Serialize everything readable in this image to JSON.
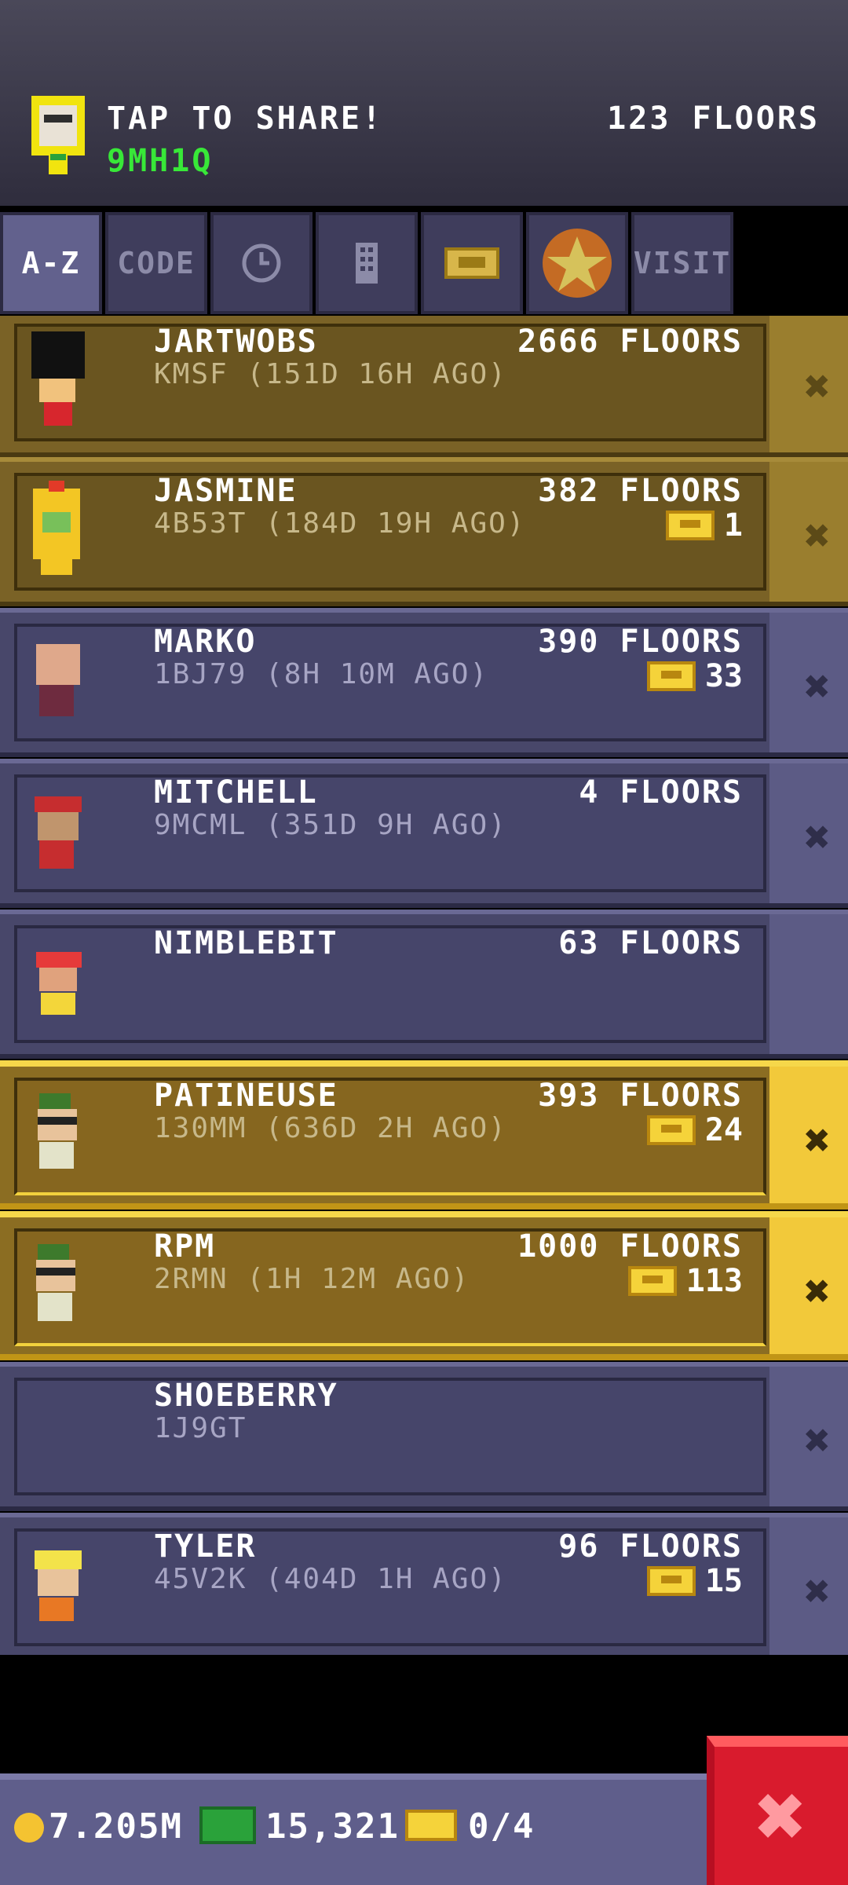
{
  "header": {
    "share_label": "TAP TO SHARE!",
    "share_code": "9MH1Q",
    "floors": "123 FLOORS"
  },
  "tabs": [
    {
      "label": "A-Z",
      "active": true
    },
    {
      "label": "CODE"
    },
    {
      "icon": "clock-icon"
    },
    {
      "icon": "building-icon"
    },
    {
      "icon": "bux-icon"
    },
    {
      "icon": "star-medal-icon"
    },
    {
      "label": "VISIT"
    }
  ],
  "rows": [
    {
      "name": "JARTWOBS",
      "floors": "2666 FLOORS",
      "sub": "KMSF (151D 16H AGO)",
      "bux": "",
      "style": "gold"
    },
    {
      "name": "JASMINE",
      "floors": "382 FLOORS",
      "sub": "4B53T (184D 19H AGO)",
      "bux": "1",
      "style": "gold"
    },
    {
      "name": "MARKO",
      "floors": "390 FLOORS",
      "sub": "1BJ79 (8H 10M AGO)",
      "bux": "33",
      "style": "purple"
    },
    {
      "name": "MITCHELL",
      "floors": "4 FLOORS",
      "sub": "9MCML (351D 9H AGO)",
      "bux": "",
      "style": "purple"
    },
    {
      "name": "NIMBLEBIT",
      "floors": "63 FLOORS",
      "sub": "",
      "bux": "",
      "style": "purple"
    },
    {
      "name": "PATINEUSE",
      "floors": "393 FLOORS",
      "sub": "130MM (636D 2H AGO)",
      "bux": "24",
      "style": "goldbright"
    },
    {
      "name": "RPM",
      "floors": "1000 FLOORS",
      "sub": "2RMN (1H 12M AGO)",
      "bux": "113",
      "style": "goldbright"
    },
    {
      "name": "SHOEBERRY",
      "floors": "",
      "sub": "1J9GT",
      "bux": "",
      "style": "purple"
    },
    {
      "name": "TYLER",
      "floors": "96 FLOORS",
      "sub": "45V2K (404D 1H AGO)",
      "bux": "15",
      "style": "purple"
    }
  ],
  "bottom": {
    "coins": "7.205M",
    "bux": "15,321",
    "tickets": "0/4"
  },
  "colors": {
    "accent_green": "#38e838",
    "gold_row": "#7a6226",
    "purple_row": "#48476a",
    "close_red": "#d91b2d"
  }
}
